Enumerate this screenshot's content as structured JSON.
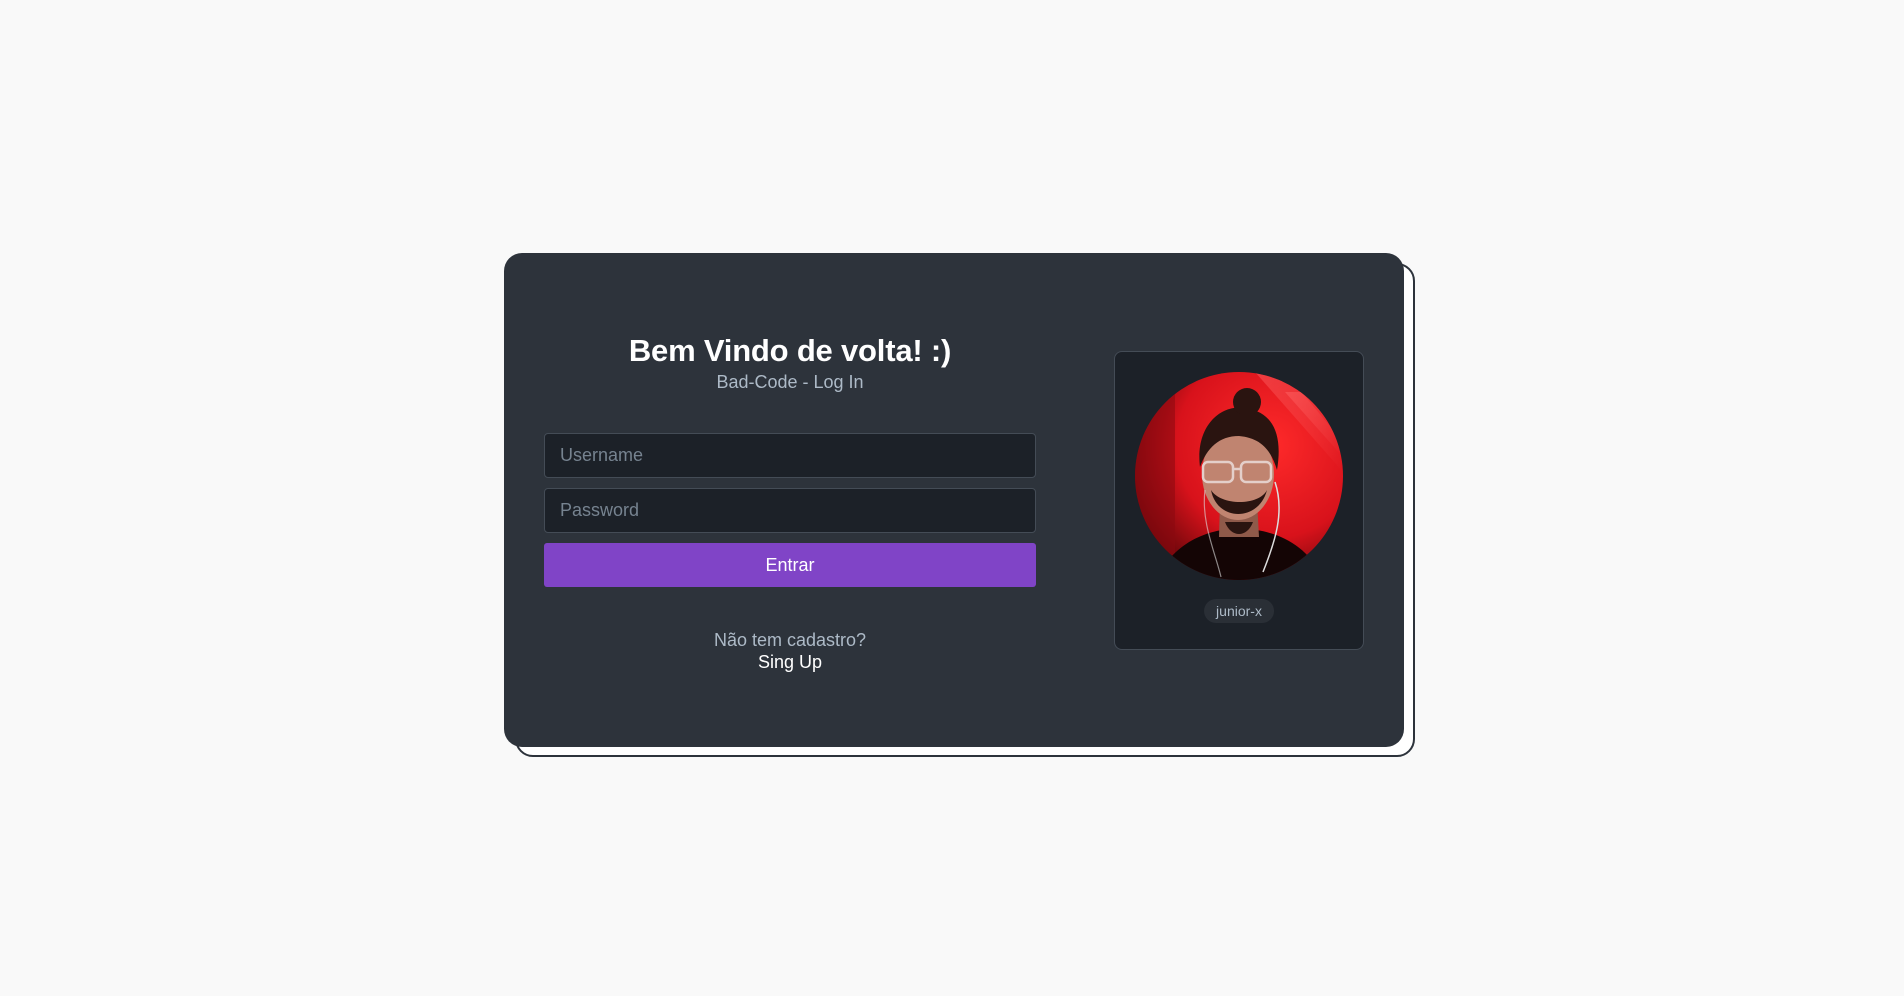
{
  "login": {
    "title": "Bem Vindo de volta! :)",
    "subtitle": "Bad-Code - Log In",
    "username_placeholder": "Username",
    "password_placeholder": "Password",
    "submit_label": "Entrar",
    "signup_prompt": "Não tem cadastro?",
    "signup_link": "Sing Up"
  },
  "profile": {
    "handle": "junior-x"
  },
  "colors": {
    "page_bg": "#f9f9f9",
    "card_bg": "#2d333b",
    "input_bg": "#1c2128",
    "accent": "#8044c7",
    "text_primary": "#ffffff",
    "text_secondary": "#adbac7"
  }
}
